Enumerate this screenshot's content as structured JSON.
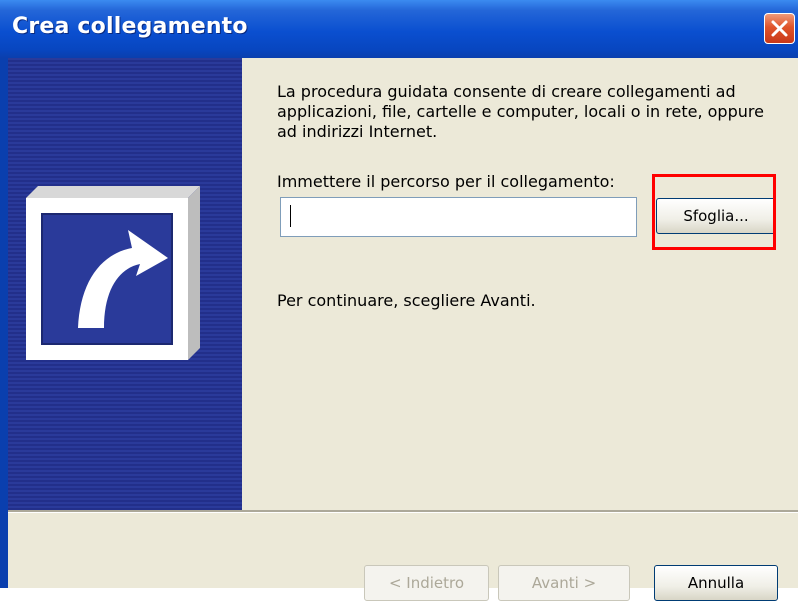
{
  "window": {
    "title": "Crea collegamento",
    "close_icon": "close-icon"
  },
  "wizard": {
    "description": "La procedura guidata consente di creare collegamenti ad applicazioni, file, cartelle e computer, locali o in rete, oppure ad indirizzi Internet.",
    "path_label": "Immettere il percorso per il collegamento:",
    "path_value": "",
    "browse_label": "Sfoglia...",
    "continue_text": "Per continuare, scegliere Avanti.",
    "sidebar_icon": "shortcut-arrow-icon"
  },
  "footer": {
    "back_label": "< Indietro",
    "next_label": "Avanti >",
    "cancel_label": "Annulla"
  },
  "colors": {
    "titlebar": "#0a4fd0",
    "sidebar": "#2a3a9a",
    "highlight": "#ff0000"
  }
}
